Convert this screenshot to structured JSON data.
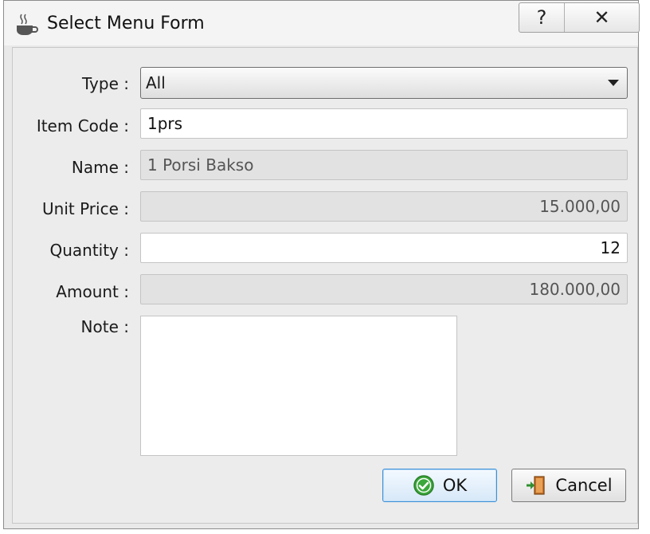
{
  "window": {
    "title": "Select Menu Form",
    "help_glyph": "?",
    "close_glyph": "✕"
  },
  "form": {
    "type_label": "Type :",
    "type_value": "All",
    "item_code_label": "Item Code :",
    "item_code_value": "1prs",
    "name_label": "Name :",
    "name_value": "1 Porsi Bakso",
    "unit_price_label": "Unit Price :",
    "unit_price_value": "15.000,00",
    "quantity_label": "Quantity :",
    "quantity_value": "12",
    "amount_label": "Amount :",
    "amount_value": "180.000,00",
    "note_label": "Note :",
    "note_value": ""
  },
  "buttons": {
    "ok_label": "OK",
    "cancel_label": "Cancel"
  },
  "icons": {
    "app": "coffee-cup-icon",
    "ok": "check-circle-icon",
    "cancel": "exit-door-icon"
  },
  "colors": {
    "ok_border": "#3c8fd6",
    "check_green": "#3aa83a"
  }
}
